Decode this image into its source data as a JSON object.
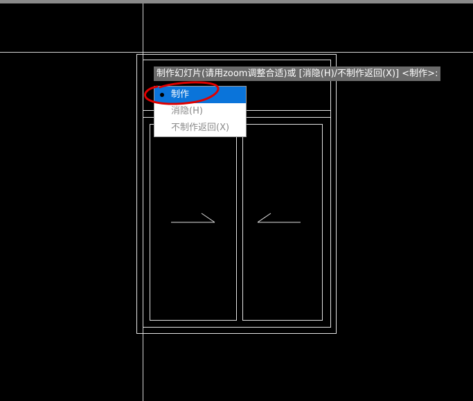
{
  "command_prompt": {
    "text": "制作幻灯片(请用zoom调整合适)或 [消隐(H)/不制作返回(X)] <制作>:"
  },
  "context_menu": {
    "items": [
      {
        "label": "制作",
        "selected": true
      },
      {
        "label": "消隐(H)",
        "selected": false
      },
      {
        "label": "不制作返回(X)",
        "selected": false
      }
    ]
  },
  "colors": {
    "background": "#000000",
    "drawing_lines": "#e6e6e6",
    "prompt_background": "#6b6b6b",
    "menu_selected": "#0a74da",
    "annotation": "#e00000"
  }
}
